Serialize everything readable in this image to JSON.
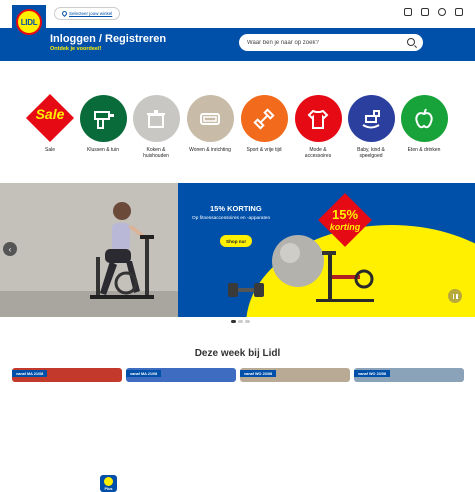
{
  "logo": {
    "text": "LIDL"
  },
  "topbar": {
    "store_label": "Selecteer jouw winkel"
  },
  "header": {
    "title": "Inloggen / Registreren",
    "subtitle": "Ontdek je voordeel!",
    "search_placeholder": "Waar ben je naar op zoek?"
  },
  "categories": [
    {
      "label": "Sale",
      "label2": "",
      "color": "#e60a14"
    },
    {
      "label": "Klussen & tuin",
      "label2": "",
      "color": "#0a6b3a"
    },
    {
      "label": "Koken &",
      "label2": "huishouden",
      "color": "#c9c7c4"
    },
    {
      "label": "Wonen & inrichting",
      "label2": "",
      "color": "#c8bba7"
    },
    {
      "label": "Sport & vrije tijd",
      "label2": "",
      "color": "#f26a1b"
    },
    {
      "label": "Mode &",
      "label2": "accessoires",
      "color": "#e60a14"
    },
    {
      "label": "Baby, kind &",
      "label2": "speelgoed",
      "color": "#2b3f9e"
    },
    {
      "label": "Eten & drinken",
      "label2": "",
      "color": "#18a23a"
    }
  ],
  "hero": {
    "title": "15% KORTING",
    "subtitle": "Op fitnessaccessoires en -apparaten",
    "button": "Shop nu!",
    "badge_top": "15%",
    "badge_bottom": "korting",
    "plus_label": "Plus"
  },
  "section": {
    "title": "Deze week bij Lidl"
  },
  "cards": [
    {
      "tag": "vanaf MA 21/08",
      "color": "#c33a2c"
    },
    {
      "tag": "vanaf MA 21/08",
      "color": "#3d6cc0"
    },
    {
      "tag": "vanaf WO 23/08",
      "color": "#b9aa96"
    },
    {
      "tag": "vanaf WO 23/08",
      "color": "#8aa3b8"
    }
  ]
}
